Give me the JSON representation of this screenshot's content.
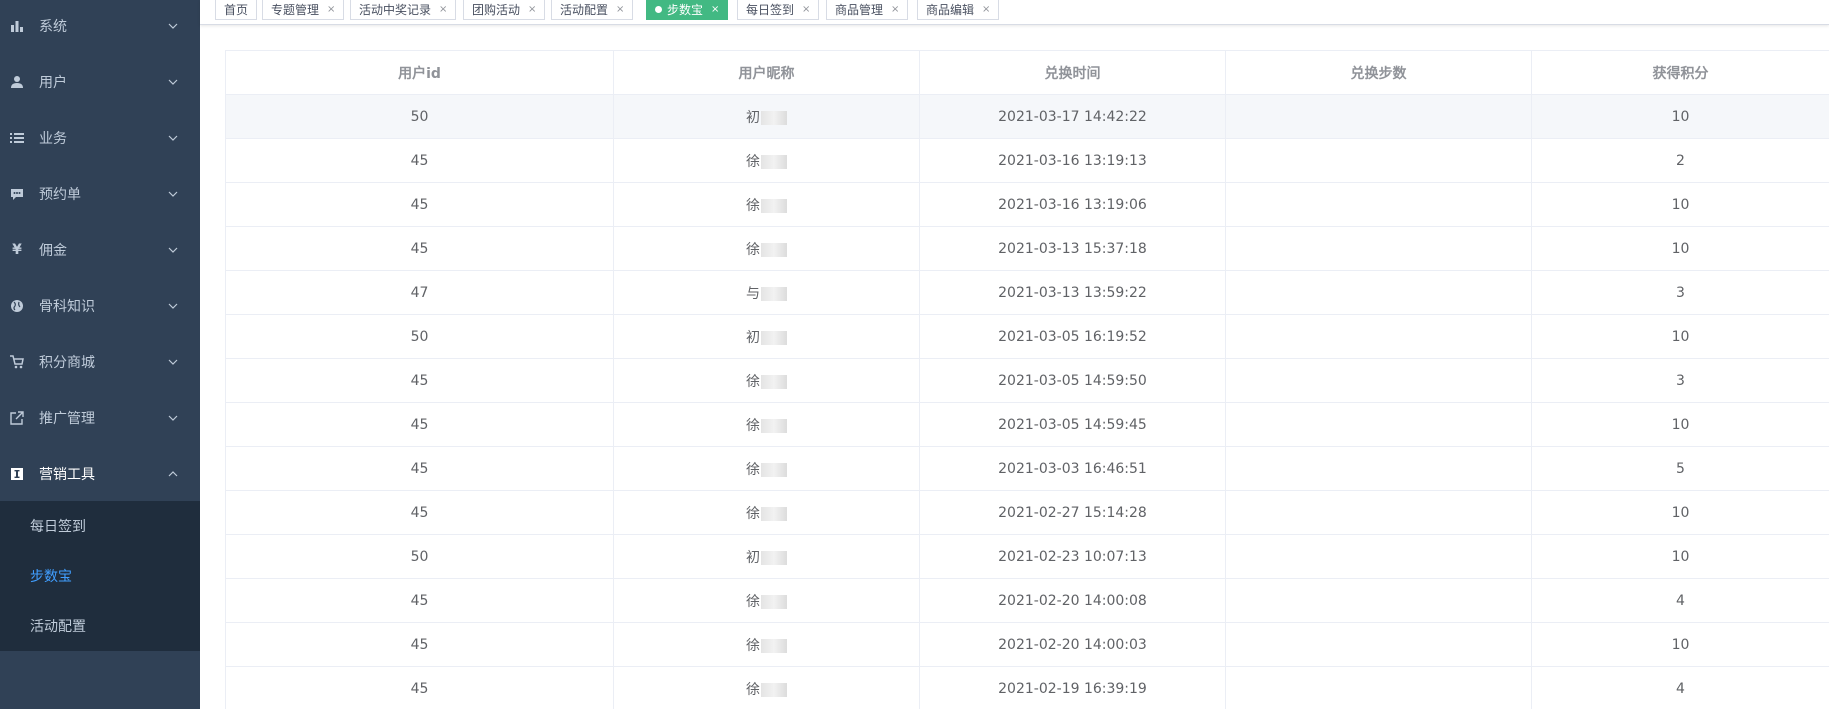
{
  "sidebar": {
    "items": [
      {
        "label": "系统",
        "icon": "bar-chart-icon"
      },
      {
        "label": "用户",
        "icon": "user-icon"
      },
      {
        "label": "业务",
        "icon": "list-icon"
      },
      {
        "label": "预约单",
        "icon": "chat-icon"
      },
      {
        "label": "佣金",
        "icon": "yen-icon"
      },
      {
        "label": "骨科知识",
        "icon": "globe-icon"
      },
      {
        "label": "积分商城",
        "icon": "cart-icon"
      },
      {
        "label": "推广管理",
        "icon": "external-link-icon"
      },
      {
        "label": "营销工具",
        "icon": "text-box-icon"
      }
    ],
    "subitems": [
      {
        "label": "每日签到"
      },
      {
        "label": "步数宝"
      },
      {
        "label": "活动配置"
      }
    ]
  },
  "tags": [
    {
      "label": "首页"
    },
    {
      "label": "专题管理",
      "close": "×"
    },
    {
      "label": "活动中奖记录",
      "close": "×"
    },
    {
      "label": "团购活动",
      "close": "×"
    },
    {
      "label": "活动配置",
      "close": "×"
    },
    {
      "label": "步数宝",
      "close": "×"
    },
    {
      "label": "每日签到",
      "close": "×"
    },
    {
      "label": "商品管理",
      "close": "×"
    },
    {
      "label": "商品编辑",
      "close": "×"
    }
  ],
  "table": {
    "headers": [
      "用户id",
      "用户昵称",
      "兑换时间",
      "兑换步数",
      "获得积分"
    ],
    "rows": [
      {
        "id": "50",
        "nick": "初",
        "time": "2021-03-17 14:42:22",
        "steps": "",
        "points": "10"
      },
      {
        "id": "45",
        "nick": "徐",
        "time": "2021-03-16 13:19:13",
        "steps": "",
        "points": "2"
      },
      {
        "id": "45",
        "nick": "徐",
        "time": "2021-03-16 13:19:06",
        "steps": "",
        "points": "10"
      },
      {
        "id": "45",
        "nick": "徐",
        "time": "2021-03-13 15:37:18",
        "steps": "",
        "points": "10"
      },
      {
        "id": "47",
        "nick": "与",
        "time": "2021-03-13 13:59:22",
        "steps": "",
        "points": "3"
      },
      {
        "id": "50",
        "nick": "初",
        "time": "2021-03-05 16:19:52",
        "steps": "",
        "points": "10"
      },
      {
        "id": "45",
        "nick": "徐",
        "time": "2021-03-05 14:59:50",
        "steps": "",
        "points": "3"
      },
      {
        "id": "45",
        "nick": "徐",
        "time": "2021-03-05 14:59:45",
        "steps": "",
        "points": "10"
      },
      {
        "id": "45",
        "nick": "徐",
        "time": "2021-03-03 16:46:51",
        "steps": "",
        "points": "5"
      },
      {
        "id": "45",
        "nick": "徐",
        "time": "2021-02-27 15:14:28",
        "steps": "",
        "points": "10"
      },
      {
        "id": "50",
        "nick": "初",
        "time": "2021-02-23 10:07:13",
        "steps": "",
        "points": "10"
      },
      {
        "id": "45",
        "nick": "徐",
        "time": "2021-02-20 14:00:08",
        "steps": "",
        "points": "4"
      },
      {
        "id": "45",
        "nick": "徐",
        "time": "2021-02-20 14:00:03",
        "steps": "",
        "points": "10"
      },
      {
        "id": "45",
        "nick": "徐",
        "time": "2021-02-19 16:39:19",
        "steps": "",
        "points": "4"
      }
    ]
  }
}
